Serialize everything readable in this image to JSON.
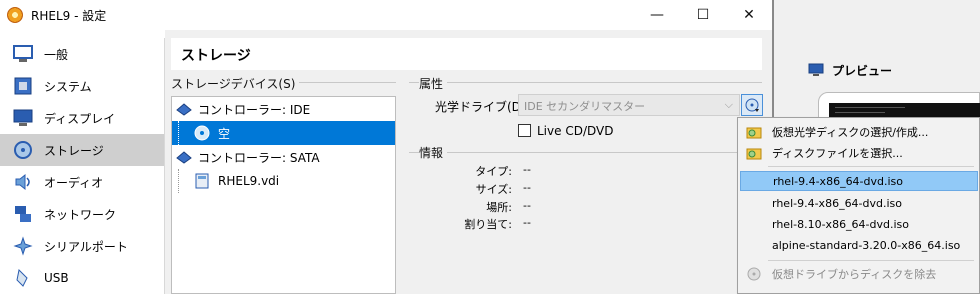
{
  "window": {
    "title": "RHEL9 - 設定",
    "minimize": "—",
    "maximize": "☐",
    "close": "✕"
  },
  "sidebar": {
    "items": [
      {
        "label": "一般",
        "icon": "general-icon"
      },
      {
        "label": "システム",
        "icon": "system-icon"
      },
      {
        "label": "ディスプレイ",
        "icon": "display-icon"
      },
      {
        "label": "ストレージ",
        "icon": "storage-icon",
        "selected": true
      },
      {
        "label": "オーディオ",
        "icon": "audio-icon"
      },
      {
        "label": "ネットワーク",
        "icon": "network-icon"
      },
      {
        "label": "シリアルポート",
        "icon": "serial-port-icon"
      },
      {
        "label": "USB",
        "icon": "usb-icon"
      }
    ]
  },
  "page": {
    "title": "ストレージ"
  },
  "storage_devices": {
    "header": "ストレージデバイス(S)",
    "tree": [
      {
        "label": "コントローラー: IDE",
        "level": 0,
        "icon": "ide-controller-icon"
      },
      {
        "label": "空",
        "level": 1,
        "icon": "optical-disc-icon",
        "selected": true
      },
      {
        "label": "コントローラー: SATA",
        "level": 0,
        "icon": "sata-controller-icon"
      },
      {
        "label": "RHEL9.vdi",
        "level": 1,
        "icon": "hard-disk-icon"
      }
    ]
  },
  "attributes": {
    "header": "属性",
    "optical_drive_label": "光学ドライブ(D):",
    "optical_drive_value": "IDE セカンダリマスター",
    "live_cd_label": "Live CD/DVD"
  },
  "information": {
    "header": "情報",
    "rows": [
      {
        "key": "タイプ:",
        "value": "--"
      },
      {
        "key": "サイズ:",
        "value": "--"
      },
      {
        "key": "場所:",
        "value": "--"
      },
      {
        "key": "割り当て:",
        "value": "--"
      }
    ]
  },
  "preview": {
    "title": "プレビュー"
  },
  "menu": {
    "choose_create": "仮想光学ディスクの選択/作成...",
    "choose_file": "ディスクファイルを選択...",
    "isos": [
      "rhel-9.4-x86_64-dvd.iso",
      "rhel-9.4-x86_64-dvd.iso",
      "rhel-8.10-x86_64-dvd.iso",
      "alpine-standard-3.20.0-x86_64.iso"
    ],
    "remove": "仮想ドライブからディスクを除去"
  },
  "colors": {
    "selection": "#0078d7",
    "menu_highlight": "#91c9f7"
  }
}
